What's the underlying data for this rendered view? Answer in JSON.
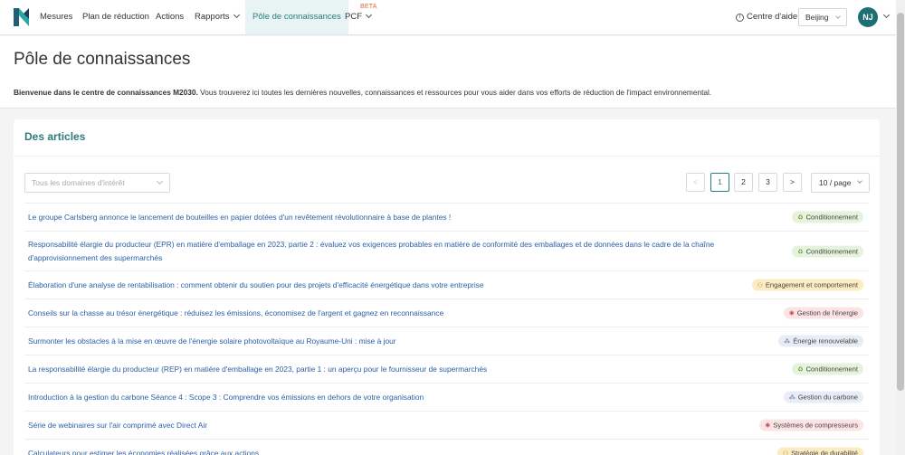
{
  "nav": {
    "items": [
      {
        "label": "Mesures"
      },
      {
        "label": "Plan de réduction"
      },
      {
        "label": "Actions"
      },
      {
        "label": "Rapports"
      },
      {
        "label": "Pôle de connaissances"
      },
      {
        "label": "PCF"
      }
    ],
    "beta": "BETA",
    "help": "Centre d'aide",
    "city": "Beijing",
    "avatar": "NJ"
  },
  "header": {
    "title": "Pôle de connaissances",
    "intro_bold": "Bienvenue dans le centre de connaissances M2030.",
    "intro_rest": " Vous trouverez ici toutes les dernières nouvelles, connaissances et ressources pour vous aider dans vos efforts de réduction de l'impact environnemental."
  },
  "articles": {
    "title": "Des articles",
    "filter_placeholder": "Tous les domaines d'intérêt",
    "pagination": {
      "prev": "<",
      "pages": [
        "1",
        "2",
        "3"
      ],
      "next": ">",
      "page_size": "10 / page",
      "current": "1"
    },
    "rows": [
      {
        "title": "Le groupe Carlsberg annonce le lancement de bouteilles en papier dotées d'un revêtement révolutionnaire à base de plantes !",
        "tag": "Conditionnement",
        "tag_icon": "recycle-icon",
        "tag_color": "#e6f3dc"
      },
      {
        "title": "Responsabilité élargie du producteur (EPR) en matière d'emballage en 2023, partie 2 : évaluez vos exigences probables en matière de conformité des emballages et de données dans le cadre de la chaîne d'approvisionnement des supermarchés",
        "tag": "Conditionnement",
        "tag_icon": "recycle-icon",
        "tag_color": "#e6f3dc"
      },
      {
        "title": "Élaboration d'une analyse de rentabilisation : comment obtenir du soutien pour des projets d'efficacité énergétique dans votre entreprise",
        "tag": "Engagement et comportement",
        "tag_icon": "people-icon",
        "tag_color": "#fbecc2"
      },
      {
        "title": "Conseils sur la chasse au trésor énergétique : réduisez les émissions, économisez de l'argent et gagnez en reconnaissance",
        "tag": "Gestion de l'énergie",
        "tag_icon": "bulb-icon",
        "tag_color": "#fbe4e6"
      },
      {
        "title": "Surmonter les obstacles à la mise en œuvre de l'énergie solaire photovoltaïque au Royaume-Uni : mise à jour",
        "tag": "Énergie renouvelable",
        "tag_icon": "molecule-icon",
        "tag_color": "#e8ecf6"
      },
      {
        "title": "La responsabilité élargie du producteur (REP) en matière d'emballage en 2023, partie 1 : un aperçu pour le fournisseur de supermarchés",
        "tag": "Conditionnement",
        "tag_icon": "recycle-icon",
        "tag_color": "#e6f3dc"
      },
      {
        "title": "Introduction à la gestion du carbone Séance 4 : Scope 3 : Comprendre vos émissions en dehors de votre organisation",
        "tag": "Gestion du carbone",
        "tag_icon": "molecule-icon",
        "tag_color": "#e8ecf6"
      },
      {
        "title": "Série de webinaires sur l'air comprimé avec Direct Air",
        "tag": "Systèmes de compresseurs",
        "tag_icon": "bulb-icon",
        "tag_color": "#fbe4e6"
      },
      {
        "title": "Calculateurs pour estimer les économies réalisées grâce aux actions",
        "tag": "Stratégie de durabilité",
        "tag_icon": "people-icon",
        "tag_color": "#fbecc2"
      }
    ]
  }
}
